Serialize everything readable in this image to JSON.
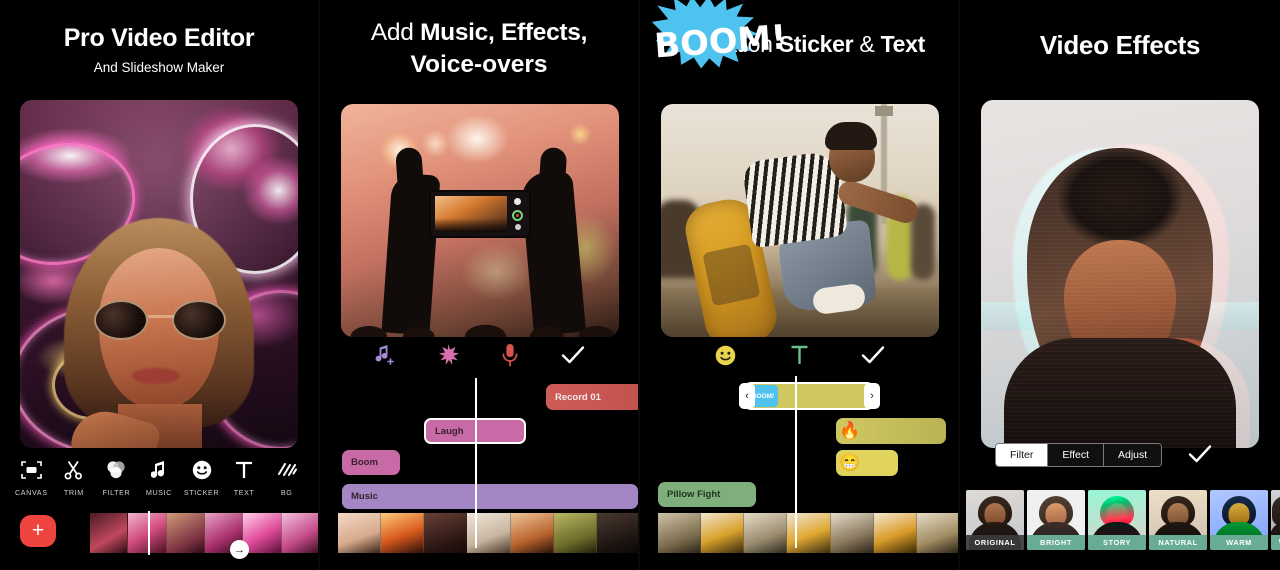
{
  "panels": [
    {
      "id": "pro-video-editor",
      "title_plain": "",
      "title": "Pro Video Editor",
      "subtitle": "And Slideshow Maker",
      "toolbar": [
        {
          "label": "CANVAS",
          "icon": "canvas-icon"
        },
        {
          "label": "TRIM",
          "icon": "scissors-icon"
        },
        {
          "label": "FILTER",
          "icon": "filter-circles-icon"
        },
        {
          "label": "MUSIC",
          "icon": "music-note-icon"
        },
        {
          "label": "STICKER",
          "icon": "smiley-icon"
        },
        {
          "label": "TEXT",
          "icon": "text-t-icon"
        },
        {
          "label": "BG",
          "icon": "background-hatch-icon"
        }
      ],
      "add_button": "+",
      "next_button": "→"
    },
    {
      "id": "music-effects-voiceovers",
      "title_lead": "Add ",
      "title_bold": "Music, Effects,",
      "title_line2": "Voice-overs",
      "icons": [
        {
          "name": "add-music-icon",
          "color": "#a48bd4"
        },
        {
          "name": "effects-starburst-icon",
          "color": "#d86fae"
        },
        {
          "name": "microphone-icon",
          "color": "#d9534f"
        },
        {
          "name": "confirm-check-icon",
          "color": "#ffffff"
        }
      ],
      "clips": [
        {
          "label": "Record 01",
          "color": "#cf5b57",
          "track": "voiceover"
        },
        {
          "label": "Laugh",
          "color": "#c86aa6",
          "track": "effect",
          "selected": true
        },
        {
          "label": "Boom",
          "color": "#c86aa6",
          "track": "effect"
        },
        {
          "label": "Music",
          "color": "#a287c4",
          "track": "music"
        }
      ]
    },
    {
      "id": "animation-sticker-text",
      "title_lead": "Animation ",
      "title_bold": "Sticker",
      "title_mid": " & ",
      "title_bold2": "Text",
      "icons": [
        {
          "name": "sticker-smiley-icon",
          "color": "#e8d44d"
        },
        {
          "name": "text-t-icon",
          "color": "#6bbd86"
        },
        {
          "name": "confirm-check-icon",
          "color": "#ffffff"
        }
      ],
      "sticker_text": "BOOM!",
      "clips": [
        {
          "label": "BOOM!",
          "color": "#cfc861",
          "track": "sticker",
          "selected": true
        },
        {
          "label": "🔥",
          "color": "#cfc861",
          "track": "sticker"
        },
        {
          "label": "😁",
          "color": "#e0d45f",
          "track": "sticker"
        },
        {
          "label": "Pillow Fight",
          "color": "#7fb07c",
          "track": "text"
        }
      ],
      "handle_left": "‹",
      "handle_right": "›"
    },
    {
      "id": "video-effects",
      "title": "Video Effects",
      "segments": [
        {
          "label": "Filter",
          "selected": true
        },
        {
          "label": "Effect",
          "selected": false
        },
        {
          "label": "Adjust",
          "selected": false
        }
      ],
      "confirm_icon": "confirm-check-icon",
      "filters": [
        {
          "label": "ORIGINAL",
          "style": "original",
          "selected": true
        },
        {
          "label": "BRIGHT",
          "style": "bright"
        },
        {
          "label": "STORY",
          "style": "story"
        },
        {
          "label": "NATURAL",
          "style": "natural"
        },
        {
          "label": "WARM",
          "style": "warm"
        },
        {
          "label": "WA",
          "style": "partial"
        }
      ]
    }
  ],
  "colors": {
    "background": "#000000",
    "accent_red": "#f0443f",
    "accent_teal": "#68ab96",
    "sticker_blue": "#4ec3ef"
  }
}
